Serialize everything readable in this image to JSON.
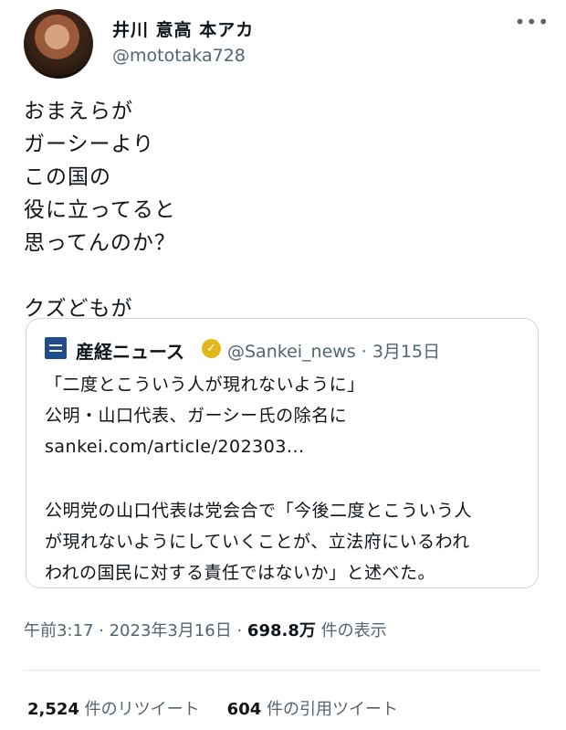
{
  "author": {
    "name": "井川 意高 本アカ",
    "handle": "@mototaka728",
    "more_icon": "•••"
  },
  "tweet": {
    "lines": [
      "おまえらが",
      "ガーシーより",
      "この国の",
      "役に立ってると",
      "思ってんのか？"
    ],
    "last_line": "クズどもが"
  },
  "quoted": {
    "name": "産経ニュース",
    "verified_icon": "✓",
    "handle": "@Sankei_news · 3月15日",
    "lines": [
      "「二度とこういう人が現れないように」",
      "公明・山口代表、ガーシー氏の除名に",
      "sankei.com/article/202303..."
    ],
    "body_lines": [
      "公明党の山口代表は党会合で「今後二度とこういう人",
      "が現れないようにしていくことが、立法府にいるわれ",
      "われの国民に対する責任ではないか」と述べた。"
    ]
  },
  "meta": {
    "time_date": "午前3:17 · 2023年3月16日 · ",
    "views_count": "698.8万",
    "views_label": " 件の表示"
  },
  "stats": {
    "retweets_count": "2,524",
    "retweets_label": " 件のリツイート",
    "quotes_count": "604",
    "quotes_label": " 件の引用ツイート"
  }
}
